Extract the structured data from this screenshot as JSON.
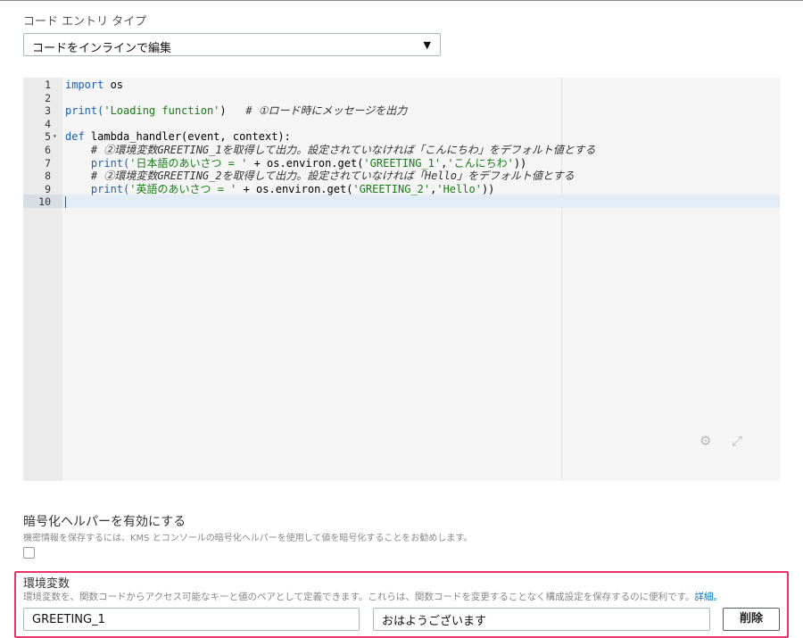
{
  "code_entry": {
    "label": "コード エントリ タイプ",
    "selected": "コードをインラインで編集"
  },
  "editor": {
    "lines": [
      {
        "n": "1",
        "parts": [
          {
            "t": "import",
            "c": "kw"
          },
          {
            "t": " os",
            "c": ""
          }
        ]
      },
      {
        "n": "2",
        "parts": []
      },
      {
        "n": "3",
        "parts": [
          {
            "t": "print(",
            "c": "kw"
          },
          {
            "t": "'Loading function'",
            "c": "str"
          },
          {
            "t": ")   ",
            "c": ""
          },
          {
            "t": "# ①ロード時にメッセージを出力",
            "c": "cm"
          }
        ]
      },
      {
        "n": "4",
        "parts": []
      },
      {
        "n": "5",
        "fold": true,
        "parts": [
          {
            "t": "def",
            "c": "kw"
          },
          {
            "t": " lambda_handler(event, context):",
            "c": ""
          }
        ]
      },
      {
        "n": "6",
        "parts": [
          {
            "t": "    # ②環境変数GREETING_1を取得して出力。設定されていなければ「こんにちわ」をデフォルト値とする",
            "c": "cm"
          }
        ]
      },
      {
        "n": "7",
        "parts": [
          {
            "t": "    print(",
            "c": "kw"
          },
          {
            "t": "'日本語のあいさつ = '",
            "c": "str"
          },
          {
            "t": " + os.environ.get(",
            "c": ""
          },
          {
            "t": "'GREETING_1'",
            "c": "str"
          },
          {
            "t": ",",
            "c": ""
          },
          {
            "t": "'こんにちわ'",
            "c": "str"
          },
          {
            "t": "))",
            "c": ""
          }
        ]
      },
      {
        "n": "8",
        "parts": [
          {
            "t": "    # ②環境変数GREETING_2を取得して出力。設定されていなければ「Hello」をデフォルト値とする",
            "c": "cm"
          }
        ]
      },
      {
        "n": "9",
        "parts": [
          {
            "t": "    print(",
            "c": "kw"
          },
          {
            "t": "'英語のあいさつ = '",
            "c": "str"
          },
          {
            "t": " + os.environ.get(",
            "c": ""
          },
          {
            "t": "'GREETING_2'",
            "c": "str"
          },
          {
            "t": ",",
            "c": ""
          },
          {
            "t": "'Hello'",
            "c": "str"
          },
          {
            "t": "))",
            "c": ""
          }
        ]
      },
      {
        "n": "10",
        "active": true,
        "parts": []
      }
    ],
    "icons": [
      "gear-icon",
      "fullscreen-icon"
    ]
  },
  "encryption": {
    "title": "暗号化ヘルパーを有効にする",
    "description": "機密情報を保存するには、KMS とコンソールの暗号化ヘルパーを使用して値を暗号化することをお勧めします。",
    "checked": false
  },
  "env_vars": {
    "title": "環境変数",
    "description": "環境変数を、関数コードからアクセス可能なキーと値のペアとして定義できます。これらは、関数コードを変更することなく構成設定を保存するのに便利です。",
    "details_link": "詳細。",
    "key": "GREETING_1",
    "value": "おはようございます",
    "delete_label": "削除"
  },
  "colors": {
    "highlight_border": "#e8336b",
    "link": "#0073bb",
    "keyword": "#1d5fb0",
    "string": "#1a7a1a"
  }
}
